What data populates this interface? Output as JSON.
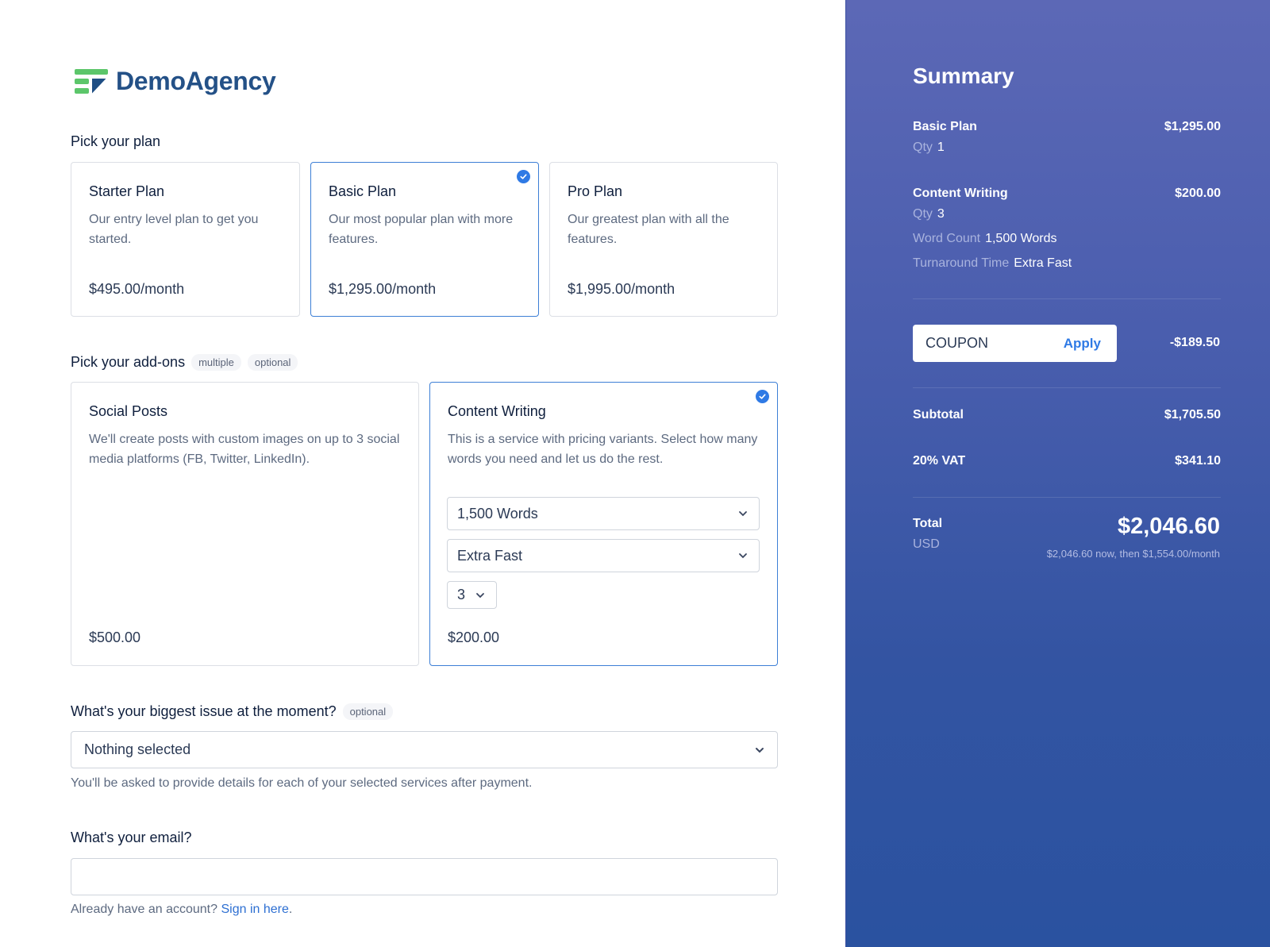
{
  "brand": {
    "name": "DemoAgency",
    "primary_color": "#245187",
    "accent_green": "#5cc66a"
  },
  "plans": {
    "label": "Pick your plan",
    "items": [
      {
        "title": "Starter Plan",
        "description": "Our entry level plan to get you started.",
        "price": "$495.00/month",
        "selected": false
      },
      {
        "title": "Basic Plan",
        "description": "Our most popular plan with more features.",
        "price": "$1,295.00/month",
        "selected": true
      },
      {
        "title": "Pro Plan",
        "description": "Our greatest plan with all the features.",
        "price": "$1,995.00/month",
        "selected": false
      }
    ]
  },
  "addons": {
    "label": "Pick your add-ons",
    "pills": [
      "multiple",
      "optional"
    ],
    "items": [
      {
        "title": "Social Posts",
        "description": "We'll create posts with custom images on up to 3 social media platforms (FB, Twitter, LinkedIn).",
        "price": "$500.00",
        "selected": false
      },
      {
        "title": "Content Writing",
        "description": "This is a service with pricing variants. Select how many words you need and let us do the rest.",
        "price": "$200.00",
        "selected": true,
        "word_count_select": "1,500 Words",
        "turnaround_select": "Extra Fast",
        "quantity_select": "3"
      }
    ]
  },
  "issue": {
    "label": "What's your biggest issue at the moment?",
    "pill": "optional",
    "selected": "Nothing selected",
    "help": "You'll be asked to provide details for each of your selected services after payment."
  },
  "email": {
    "label": "What's your email?",
    "value": "",
    "help_prefix": "Already have an account?",
    "help_link": "Sign in here",
    "help_suffix": "."
  },
  "summary": {
    "title": "Summary",
    "items": [
      {
        "name": "Basic Plan",
        "price": "$1,295.00",
        "qty_label": "Qty",
        "qty": "1"
      },
      {
        "name": "Content Writing",
        "price": "$200.00",
        "qty_label": "Qty",
        "qty": "3",
        "word_count_label": "Word Count",
        "word_count": "1,500 Words",
        "turnaround_label": "Turnaround Time",
        "turnaround": "Extra Fast"
      }
    ],
    "coupon_placeholder": "COUPON",
    "apply_label": "Apply",
    "discount": "-$189.50",
    "subtotal_label": "Subtotal",
    "subtotal": "$1,705.50",
    "vat_label": "20% VAT",
    "vat": "$341.10",
    "total_label": "Total",
    "currency": "USD",
    "total": "$2,046.60",
    "total_note": "$2,046.60 now, then $1,554.00/month",
    "gradient_top": "#5c68b6",
    "gradient_bottom": "#2a52a0"
  }
}
